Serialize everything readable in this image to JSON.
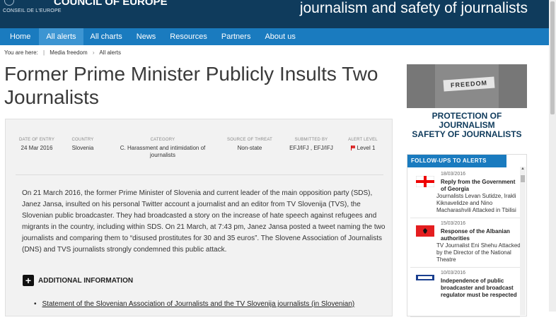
{
  "header": {
    "org_small": "CONSEIL DE L'EUROPE",
    "org_big": "COUNCIL OF EUROPE",
    "site_title": "journalism and safety of journalists"
  },
  "nav": {
    "items": [
      {
        "label": "Home"
      },
      {
        "label": "All alerts"
      },
      {
        "label": "All charts"
      },
      {
        "label": "News"
      },
      {
        "label": "Resources"
      },
      {
        "label": "Partners"
      },
      {
        "label": "About us"
      }
    ],
    "active": "All alerts"
  },
  "breadcrumb": {
    "prefix": "You are here:",
    "items": [
      "Media freedom",
      "All alerts"
    ]
  },
  "article": {
    "title": "Former Prime Minister Publicly Insults Two Journalists",
    "meta": [
      {
        "label": "Date of entry",
        "value": "24 Mar 2016"
      },
      {
        "label": "Country",
        "value": "Slovenia"
      },
      {
        "label": "Category",
        "value": "C. Harassment and intimidation of journalists"
      },
      {
        "label": "Source of threat",
        "value": "Non-state"
      },
      {
        "label": "Submitted by",
        "value": "EFJ/IFJ , EFJ/IFJ"
      },
      {
        "label": "Alert level",
        "value": "Level 1"
      }
    ],
    "body": "On 21 March 2016, the former Prime Minister of Slovenia and current leader of the main opposition party (SDS), Janez Jansa, insulted on his personal Twitter account a journalist and an editor from TV Slovenija (TVS), the Slovenian public broadcaster. They had broadcasted a story on the increase of hate speech against refugees and migrants in the country, including within SDS. On 21 March, at 7:43 pm, Janez Jansa posted a tweet naming the two journalists and comparing them to “disused prostitutes for 30 and 35 euros”. The Slovene Association of Journalists (DNS) and TVS journalists strongly condemned this public attack.",
    "additional_title": "ADDITIONAL INFORMATION",
    "links": [
      "Statement of the Slovenian Association of Journalists and the TV Slovenija journalists (in Slovenian)"
    ]
  },
  "sidebar": {
    "banner_tape": "FREEDOM",
    "banner_caption_line1": "PROTECTION OF JOURNALISM",
    "banner_caption_line2": "SAFETY OF JOURNALISTS",
    "followups_title": "FOLLOW-UPS TO ALERTS",
    "followups": [
      {
        "date": "18/03/2016",
        "title": "Reply from the Government of Georgia",
        "text": "Journalists Levan Sutidze, Irakli Kiknavelidze and Nino Macharashvili Attacked in Tbilisi",
        "flag": "georgia-flag-icon"
      },
      {
        "date": "15/03/2016",
        "title": "Response of the Albanian authorities",
        "text": "TV Journalist Eni Shehu Attacked by the Director of the National Theatre",
        "flag": "albania-flag-icon"
      },
      {
        "date": "10/03/2016",
        "title": "Independence of public broadcaster and broadcast regulator must be respected",
        "text": "",
        "flag": "osce-logo-icon"
      }
    ]
  },
  "colors": {
    "header_bg": "#0f3b5c",
    "nav_bg": "#1a7bbf",
    "nav_active": "#3d95d2",
    "panel_bg": "#f2f2f2",
    "alert_red": "#d33"
  }
}
